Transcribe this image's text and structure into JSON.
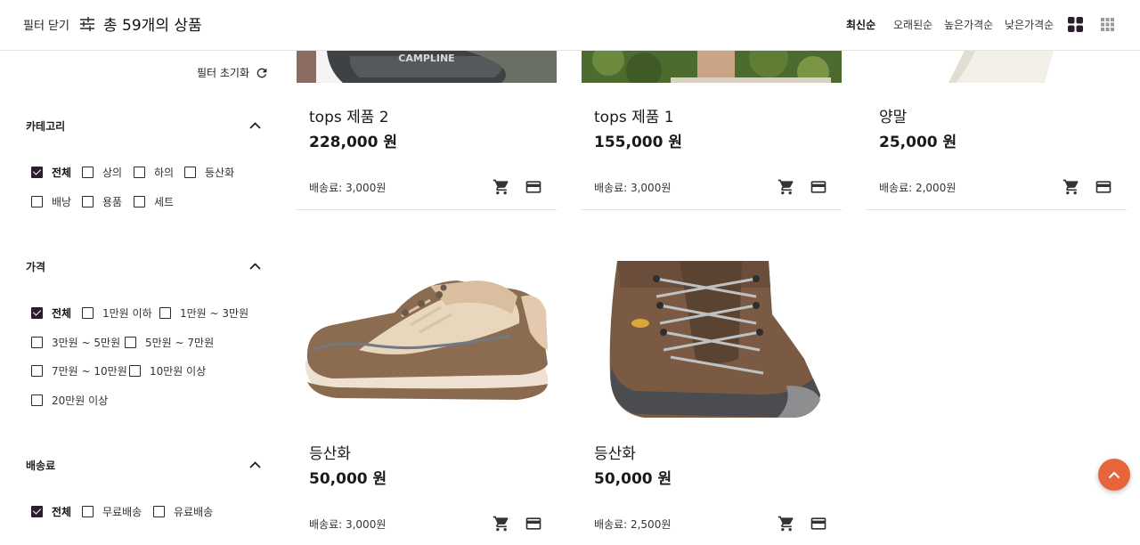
{
  "header": {
    "close_filter_label": "필터 닫기",
    "total_label": "총 59개의 상품",
    "sort_options": [
      {
        "label": "최신순",
        "active": true
      },
      {
        "label": "오래된순",
        "active": false
      },
      {
        "label": "높은가격순",
        "active": false
      },
      {
        "label": "낮은가격순",
        "active": false
      }
    ],
    "view_modes": [
      "grid-large-icon",
      "grid-small-icon"
    ],
    "active_view": "grid-large-icon"
  },
  "sidebar": {
    "reset_label": "필터 초기화",
    "sections": {
      "category": {
        "title": "카테고리",
        "options": [
          {
            "label": "전체",
            "checked": true
          },
          {
            "label": "상의",
            "checked": false
          },
          {
            "label": "하의",
            "checked": false
          },
          {
            "label": "등산화",
            "checked": false
          },
          {
            "label": "배낭",
            "checked": false
          },
          {
            "label": "용품",
            "checked": false
          },
          {
            "label": "세트",
            "checked": false
          }
        ]
      },
      "price": {
        "title": "가격",
        "options": [
          {
            "label": "전체",
            "checked": true
          },
          {
            "label": "1만원 이하",
            "checked": false
          },
          {
            "label": "1만원 ~ 3만원",
            "checked": false
          },
          {
            "label": "3만원 ~ 5만원",
            "checked": false
          },
          {
            "label": "5만원 ~ 7만원",
            "checked": false
          },
          {
            "label": "7만원 ~ 10만원",
            "checked": false
          },
          {
            "label": "10만원 이상",
            "checked": false
          },
          {
            "label": "20만원 이상",
            "checked": false
          }
        ]
      },
      "shipping": {
        "title": "배송료",
        "options": [
          {
            "label": "전체",
            "checked": true
          },
          {
            "label": "무료배송",
            "checked": false
          },
          {
            "label": "유료배송",
            "checked": false
          }
        ]
      }
    }
  },
  "products": [
    {
      "name": "tops 제품 2",
      "price": "228,000 원",
      "shipping": "배송료: 3,000원",
      "image": "hiking-shoe-image"
    },
    {
      "name": "tops 제품 1",
      "price": "155,000 원",
      "shipping": "배송료: 3,000원",
      "image": "outdoor-photo-image"
    },
    {
      "name": "양말",
      "price": "25,000 원",
      "shipping": "배송료: 2,000원",
      "image": "sock-image"
    },
    {
      "name": "등산화",
      "price": "50,000 원",
      "shipping": "배송료: 3,000원",
      "image": "beige-hiking-shoe-image"
    },
    {
      "name": "등산화",
      "price": "50,000 원",
      "shipping": "배송료: 2,500원",
      "image": "brown-hiking-boot-image"
    }
  ],
  "colors": {
    "accent": "#e7653c",
    "checkbox_checked": "#2a1e2d",
    "divider": "#e2e2e2"
  }
}
